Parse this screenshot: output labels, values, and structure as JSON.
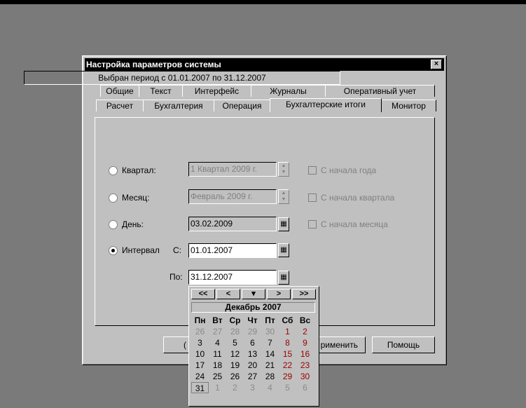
{
  "window": {
    "title": "Настройка параметров системы",
    "close_glyph": "×"
  },
  "tabs_row1": [
    "Общие",
    "Текст",
    "Интерфейс",
    "Журналы",
    "Оперативный учет"
  ],
  "tabs_row2": [
    "Расчет",
    "Бухгалтерия",
    "Операция",
    "Бухгалтерские итоги",
    "Монитор"
  ],
  "active_tab": "Бухгалтерские итоги",
  "period_text": "Выбран период с 01.01.2007 по 31.12.2007",
  "rows": {
    "quarter": {
      "label": "Квартал:",
      "value": "1 Квартал 2009 г.",
      "check": "С начала года",
      "selected": false
    },
    "month": {
      "label": "Месяц:",
      "value": "Февраль 2009 г.",
      "check": "С начала квартала",
      "selected": false
    },
    "day": {
      "label": "День:",
      "value": "03.02.2009",
      "check": "С начала месяца",
      "selected": false
    },
    "interval": {
      "label": "Интервал",
      "from_label": "С:",
      "from": "01.01.2007",
      "to_label": "По:",
      "to": "31.12.2007",
      "selected": true
    }
  },
  "buttons": {
    "ok_partial": "(",
    "apply": "рименить",
    "help": "Помощь"
  },
  "calendar": {
    "nav": [
      "<<",
      "<",
      "▾",
      ">",
      ">>"
    ],
    "month": "Декабрь 2007",
    "weekdays": [
      "Пн",
      "Вт",
      "Ср",
      "Чт",
      "Пт",
      "Сб",
      "Вс"
    ],
    "weeks": [
      [
        "26",
        "27",
        "28",
        "29",
        "30",
        "1",
        "2"
      ],
      [
        "3",
        "4",
        "5",
        "6",
        "7",
        "8",
        "9"
      ],
      [
        "10",
        "11",
        "12",
        "13",
        "14",
        "15",
        "16"
      ],
      [
        "17",
        "18",
        "19",
        "20",
        "21",
        "22",
        "23"
      ],
      [
        "24",
        "25",
        "26",
        "27",
        "28",
        "29",
        "30"
      ],
      [
        "31",
        "1",
        "2",
        "3",
        "4",
        "5",
        "6"
      ]
    ],
    "selected": "31"
  }
}
